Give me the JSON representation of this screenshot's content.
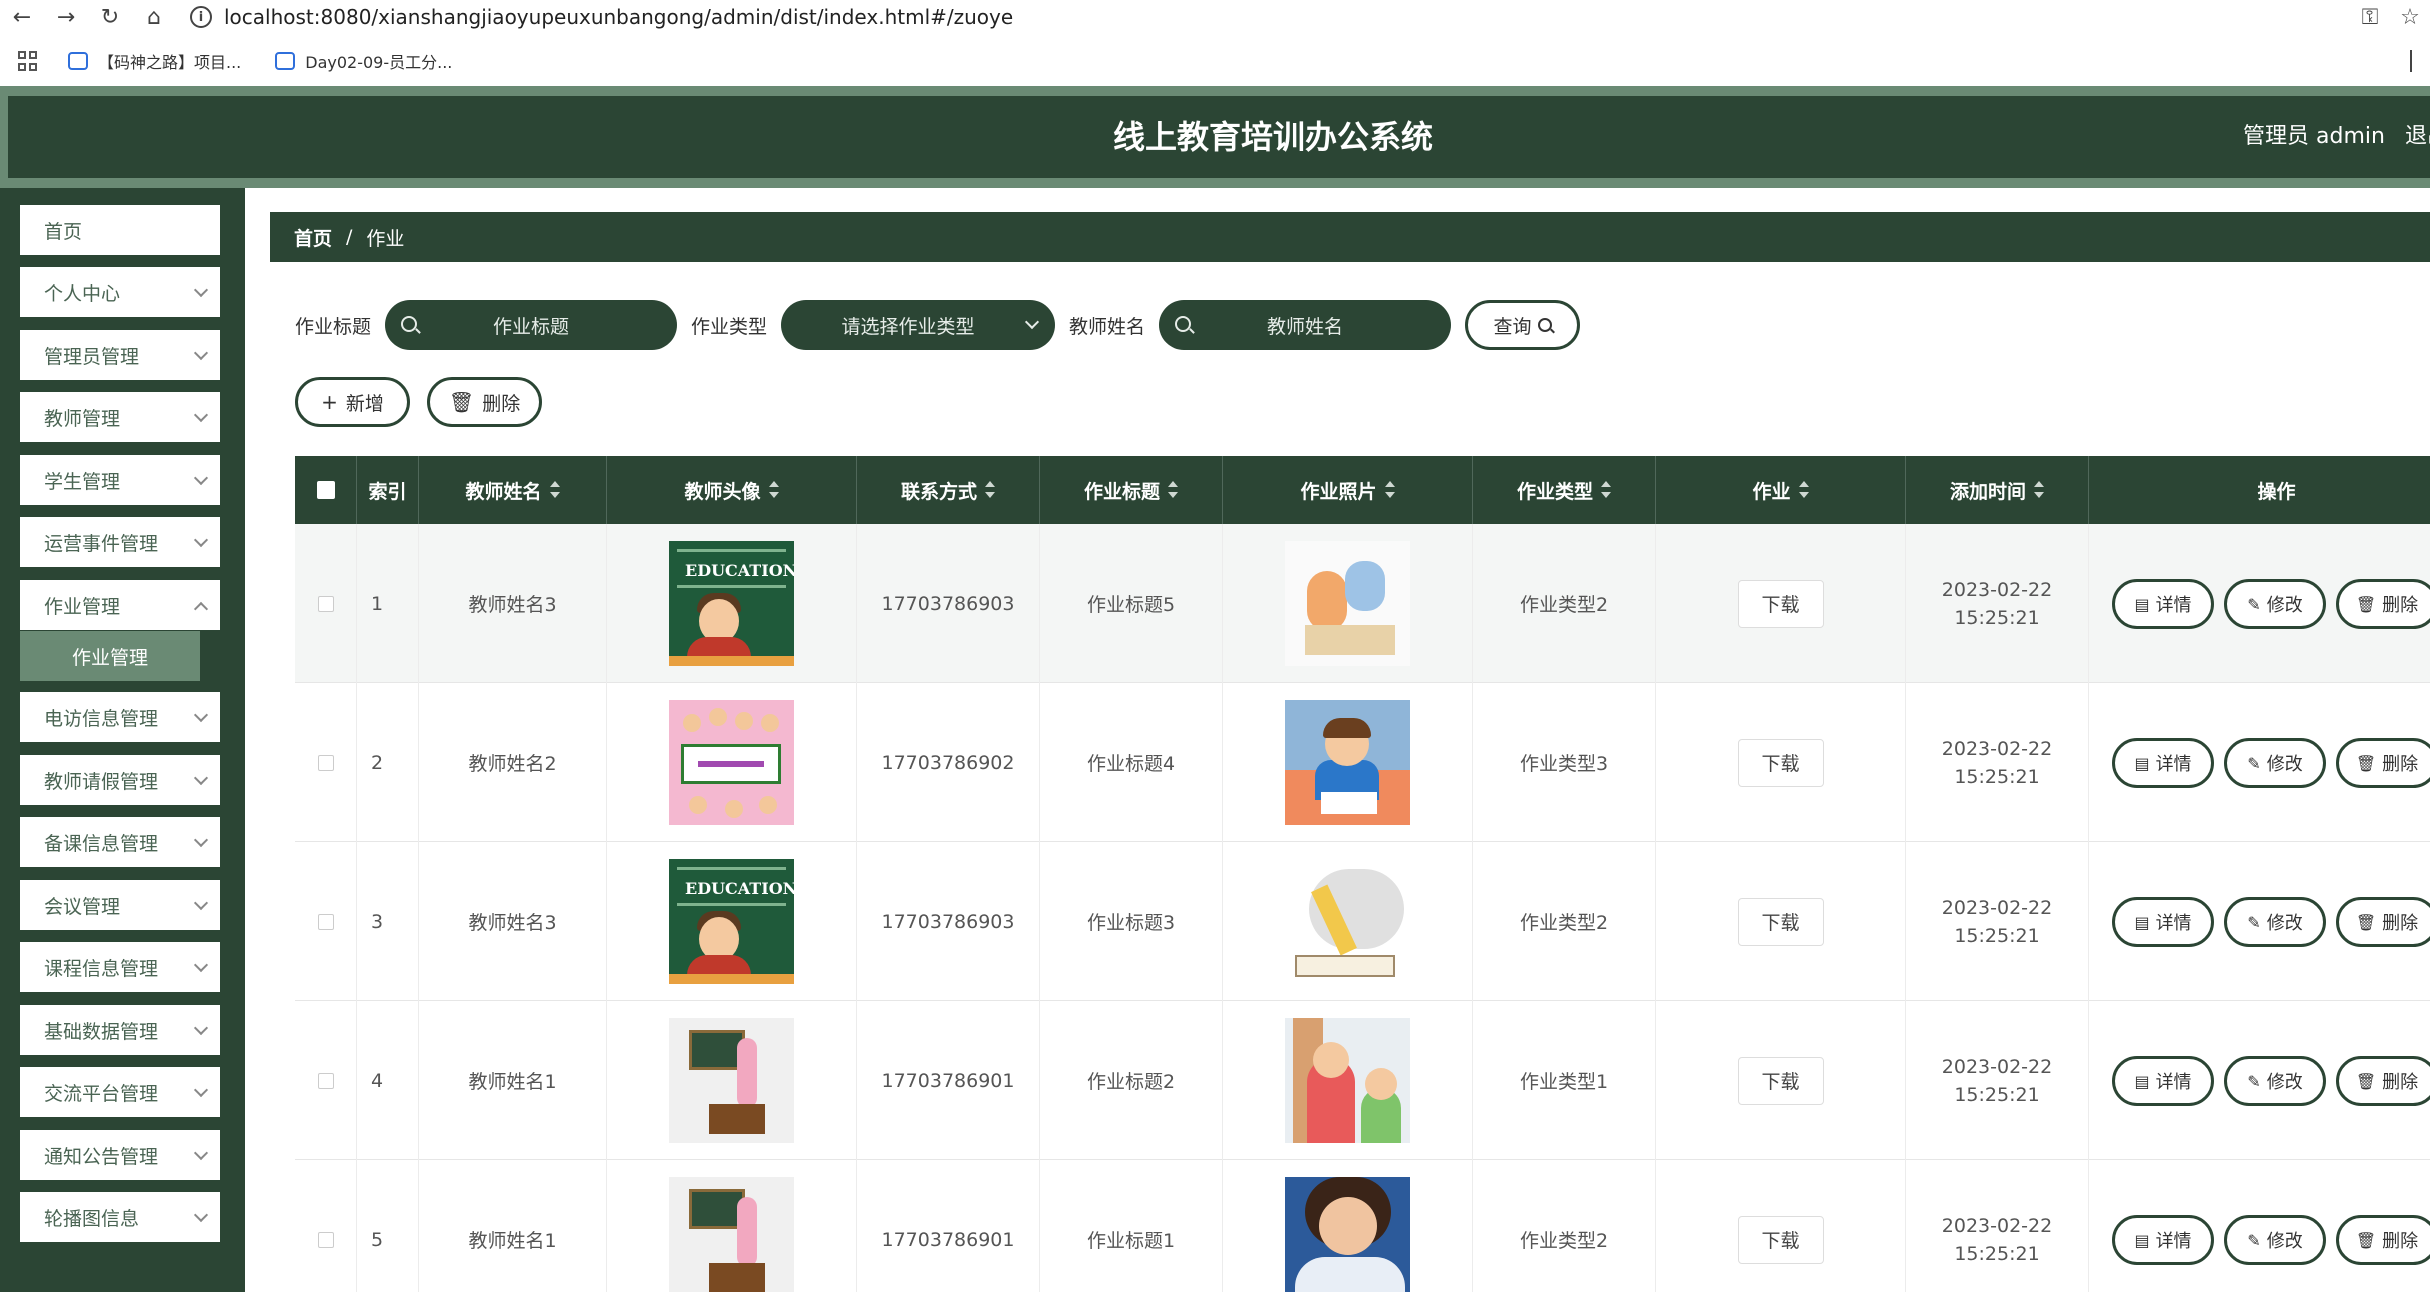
{
  "browser": {
    "url": "localhost:8080/xianshangjiaoyupeuxunbangong/admin/dist/index.html#/zuoye",
    "bookmarks": [
      "【码神之路】项目...",
      "Day02-09-员工分..."
    ]
  },
  "header": {
    "title": "线上教育培训办公系统",
    "user": "管理员 admin",
    "logout": "退出"
  },
  "sidebar": {
    "items": [
      {
        "label": "首页"
      },
      {
        "label": "个人中心"
      },
      {
        "label": "管理员管理"
      },
      {
        "label": "教师管理"
      },
      {
        "label": "学生管理"
      },
      {
        "label": "运营事件管理"
      },
      {
        "label": "作业管理"
      },
      {
        "label": "电访信息管理"
      },
      {
        "label": "教师请假管理"
      },
      {
        "label": "备课信息管理"
      },
      {
        "label": "会议管理"
      },
      {
        "label": "课程信息管理"
      },
      {
        "label": "基础数据管理"
      },
      {
        "label": "交流平台管理"
      },
      {
        "label": "通知公告管理"
      },
      {
        "label": "轮播图信息"
      }
    ],
    "active_sub": "作业管理"
  },
  "breadcrumb": {
    "home": "首页",
    "separator": "/",
    "current": "作业"
  },
  "search": {
    "title_label": "作业标题",
    "title_placeholder": "作业标题",
    "type_label": "作业类型",
    "type_placeholder": "请选择作业类型",
    "teacher_label": "教师姓名",
    "teacher_placeholder": "教师姓名",
    "query_label": "查询"
  },
  "actions": {
    "add_label": "新增",
    "delete_label": "删除"
  },
  "table": {
    "headers": {
      "index": "索引",
      "teacher_name": "教师姓名",
      "avatar": "教师头像",
      "contact": "联系方式",
      "title": "作业标题",
      "photo": "作业照片",
      "type": "作业类型",
      "file": "作业",
      "time": "添加时间",
      "ops": "操作"
    },
    "download_label": "下载",
    "op_detail": "详情",
    "op_edit": "修改",
    "op_delete": "删除",
    "rows": [
      {
        "index": "1",
        "teacher_name": "教师姓名3",
        "contact": "17703786903",
        "title": "作业标题5",
        "type": "作业类型2",
        "time": "2023-02-22 15:25:21",
        "avatar_icon": "education-teacher-avatar",
        "photo_icon": "kids-studying-photo"
      },
      {
        "index": "2",
        "teacher_name": "教师姓名2",
        "contact": "17703786902",
        "title": "作业标题4",
        "type": "作业类型3",
        "time": "2023-02-22 15:25:21",
        "avatar_icon": "classroom-kids-avatar",
        "photo_icon": "boy-writing-photo"
      },
      {
        "index": "3",
        "teacher_name": "教师姓名3",
        "contact": "17703786903",
        "title": "作业标题3",
        "type": "作业类型2",
        "time": "2023-02-22 15:25:21",
        "avatar_icon": "education-teacher-avatar",
        "photo_icon": "pencil-book-photo"
      },
      {
        "index": "4",
        "teacher_name": "教师姓名1",
        "contact": "17703786901",
        "title": "作业标题2",
        "type": "作业类型1",
        "time": "2023-02-22 15:25:21",
        "avatar_icon": "blackboard-teacher-avatar",
        "photo_icon": "two-girls-photo"
      },
      {
        "index": "5",
        "teacher_name": "教师姓名1",
        "contact": "17703786901",
        "title": "作业标题1",
        "type": "作业类型2",
        "time": "2023-02-22 15:25:21",
        "avatar_icon": "blackboard-teacher-avatar",
        "photo_icon": "girl-writing-photo"
      }
    ]
  },
  "colors": {
    "primary": "#2b4534",
    "accent": "#6a8a74"
  }
}
